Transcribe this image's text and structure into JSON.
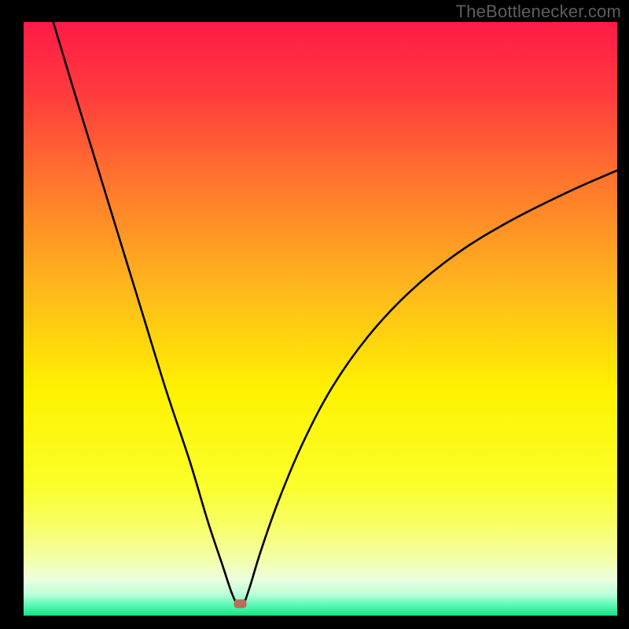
{
  "watermark": "TheBottlenecker.com",
  "chart_data": {
    "type": "line",
    "title": "",
    "xlabel": "",
    "ylabel": "",
    "xlim": [
      0,
      100
    ],
    "ylim": [
      0,
      100
    ],
    "gradient_stops": [
      {
        "offset": 0.0,
        "color": "#ff1b47"
      },
      {
        "offset": 0.12,
        "color": "#ff3b3d"
      },
      {
        "offset": 0.28,
        "color": "#ff7a2c"
      },
      {
        "offset": 0.45,
        "color": "#ffb81c"
      },
      {
        "offset": 0.62,
        "color": "#fff200"
      },
      {
        "offset": 0.78,
        "color": "#fbff2a"
      },
      {
        "offset": 0.85,
        "color": "#f8ff68"
      },
      {
        "offset": 0.91,
        "color": "#f3ffb0"
      },
      {
        "offset": 0.94,
        "color": "#eaffe0"
      },
      {
        "offset": 0.965,
        "color": "#b8ffd8"
      },
      {
        "offset": 0.985,
        "color": "#4cf8b0"
      },
      {
        "offset": 1.0,
        "color": "#14e27e"
      }
    ],
    "marker": {
      "x": 36.5,
      "y": 2.0,
      "color": "#b96c5a"
    },
    "series": [
      {
        "name": "curve",
        "x": [
          5.0,
          8.0,
          12.0,
          16.0,
          20.0,
          24.0,
          28.0,
          31.0,
          33.5,
          35.0,
          36.0,
          37.0,
          38.0,
          40.0,
          43.0,
          47.0,
          52.0,
          58.0,
          65.0,
          73.0,
          82.0,
          92.0,
          100.0
        ],
        "y": [
          100.0,
          90.0,
          77.0,
          64.0,
          51.0,
          38.0,
          26.0,
          16.0,
          8.5,
          4.0,
          2.0,
          2.0,
          4.5,
          11.0,
          19.5,
          29.0,
          38.5,
          47.0,
          54.5,
          61.0,
          66.5,
          71.5,
          75.0
        ]
      }
    ]
  }
}
